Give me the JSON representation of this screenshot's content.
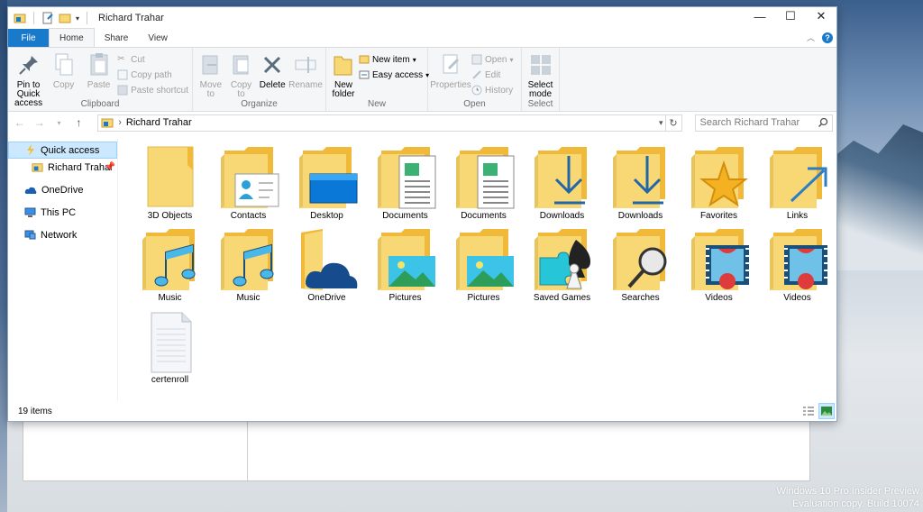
{
  "window": {
    "title": "Richard Trahar",
    "controls": {
      "minimize": "—",
      "maximize": "☐",
      "close": "✕"
    }
  },
  "tabs": [
    {
      "label": "File"
    },
    {
      "label": "Home"
    },
    {
      "label": "Share"
    },
    {
      "label": "View"
    }
  ],
  "ribbon": {
    "clipboard": {
      "label": "Clipboard",
      "pin": "Pin to Quick access",
      "copy": "Copy",
      "paste": "Paste",
      "cut": "Cut",
      "copy_path": "Copy path",
      "paste_shortcut": "Paste shortcut"
    },
    "organize": {
      "label": "Organize",
      "move_to": "Move to",
      "copy_to": "Copy to",
      "delete": "Delete",
      "rename": "Rename"
    },
    "new": {
      "label": "New",
      "new_folder": "New folder",
      "new_item": "New item",
      "easy_access": "Easy access"
    },
    "open": {
      "label": "Open",
      "properties": "Properties",
      "open": "Open",
      "edit": "Edit",
      "history": "History"
    },
    "select": {
      "label": "Select",
      "select_mode": "Select mode"
    }
  },
  "address": {
    "path": "Richard Trahar",
    "search_placeholder": "Search Richard Trahar"
  },
  "nav": {
    "quick_access": "Quick access",
    "richard": "Richard Trahar",
    "onedrive": "OneDrive",
    "this_pc": "This PC",
    "network": "Network"
  },
  "items": [
    {
      "label": "3D Objects",
      "icon": "folder-icon"
    },
    {
      "label": "Contacts",
      "icon": "contacts-folder-icon"
    },
    {
      "label": "Desktop",
      "icon": "desktop-folder-icon"
    },
    {
      "label": "Documents",
      "icon": "documents-folder-icon"
    },
    {
      "label": "Documents",
      "icon": "documents-folder-icon"
    },
    {
      "label": "Downloads",
      "icon": "downloads-folder-icon"
    },
    {
      "label": "Downloads",
      "icon": "downloads-folder-icon"
    },
    {
      "label": "Favorites",
      "icon": "favorites-folder-icon"
    },
    {
      "label": "Links",
      "icon": "links-folder-icon"
    },
    {
      "label": "Music",
      "icon": "music-folder-icon"
    },
    {
      "label": "Music",
      "icon": "music-folder-icon"
    },
    {
      "label": "OneDrive",
      "icon": "onedrive-folder-icon"
    },
    {
      "label": "Pictures",
      "icon": "pictures-folder-icon"
    },
    {
      "label": "Pictures",
      "icon": "pictures-folder-icon"
    },
    {
      "label": "Saved Games",
      "icon": "saved-games-folder-icon"
    },
    {
      "label": "Searches",
      "icon": "searches-folder-icon"
    },
    {
      "label": "Videos",
      "icon": "videos-folder-icon"
    },
    {
      "label": "Videos",
      "icon": "videos-folder-icon"
    },
    {
      "label": "certenroll",
      "icon": "file-icon"
    }
  ],
  "status": {
    "count": "19 items"
  },
  "desktop": {
    "watermark_line1": "Windows 10 Pro Insider Preview",
    "watermark_line2": "Evaluation copy. Build 10074"
  },
  "colors": {
    "accent": "#1979ca",
    "folder": "#f8d775",
    "folder_dark": "#e8b84a",
    "selection": "#cce8ff"
  }
}
